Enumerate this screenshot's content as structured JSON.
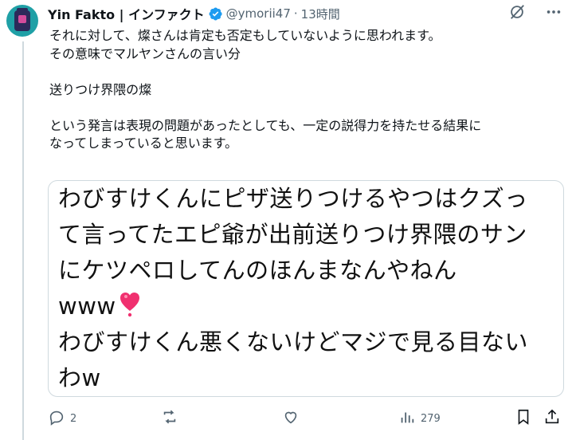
{
  "tweet": {
    "author_name": "Yin Fakto | インファクト",
    "handle": "@ymorii47",
    "separator": "·",
    "time": "13時間",
    "text": "それに対して、燦さんは肯定も否定もしていないように思われます。\nその意味でマルヤンさんの言い分\n\n送りつけ界隈の燦\n\nという発言は表現の問題があったとしても、一定の説得力を持たせる結果に\nなってしまっていると思います。"
  },
  "media": {
    "text_main": "わびすけくんにピザ送りつけるやつはクズっ\nて言ってたエピ爺が出前送りつけ界隈のサン\nにケツペロしてんのほんまなんやねん\nwww",
    "text_tail": "\nわびすけくん悪くないけどマジで見る目ない\nわw"
  },
  "actions": {
    "reply_count": "2",
    "retweet_count": "",
    "like_count": "",
    "views_count": "279"
  },
  "icons": {
    "verified": "verified-badge-icon",
    "grok": "grok-icon",
    "more": "more-icon",
    "reply": "reply-icon",
    "retweet": "retweet-icon",
    "like": "like-icon",
    "views": "views-icon",
    "bookmark": "bookmark-icon",
    "share": "share-icon"
  },
  "colors": {
    "verified_blue": "#1d9bf0",
    "muted_text": "#536471",
    "heart_pink": "#f0306f"
  }
}
